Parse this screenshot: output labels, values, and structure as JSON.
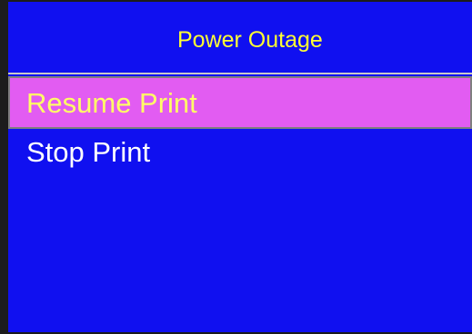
{
  "screen": {
    "background_color": "#1010f0"
  },
  "header": {
    "title": "Power Outage",
    "title_color": "#ffff33"
  },
  "menu": {
    "items": [
      {
        "label": "Resume Print",
        "selected": true,
        "highlight_color": "#e25cf2",
        "text_color": "#ffff66"
      },
      {
        "label": "Stop Print",
        "selected": false,
        "text_color": "#ffffff"
      }
    ]
  }
}
